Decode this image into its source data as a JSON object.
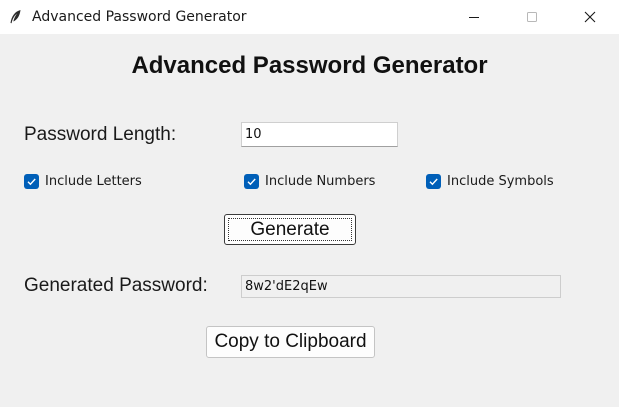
{
  "window": {
    "title": "Advanced Password Generator",
    "controls": {
      "minimize": "minimize-icon",
      "maximize": "maximize-icon",
      "close": "close-icon"
    }
  },
  "main": {
    "heading": "Advanced Password Generator",
    "length_label": "Password Length:",
    "length_value": "10",
    "options": [
      {
        "label": "Include Letters",
        "checked": true
      },
      {
        "label": "Include Numbers",
        "checked": true
      },
      {
        "label": "Include Symbols",
        "checked": true
      }
    ],
    "generate_label": "Generate",
    "generated_label": "Generated Password:",
    "generated_value": "8w2'dE2qEw",
    "copy_label": "Copy to Clipboard"
  },
  "colors": {
    "background": "#f0f0f0",
    "checkbox_accent": "#005fb8",
    "titlebar": "#ffffff"
  }
}
